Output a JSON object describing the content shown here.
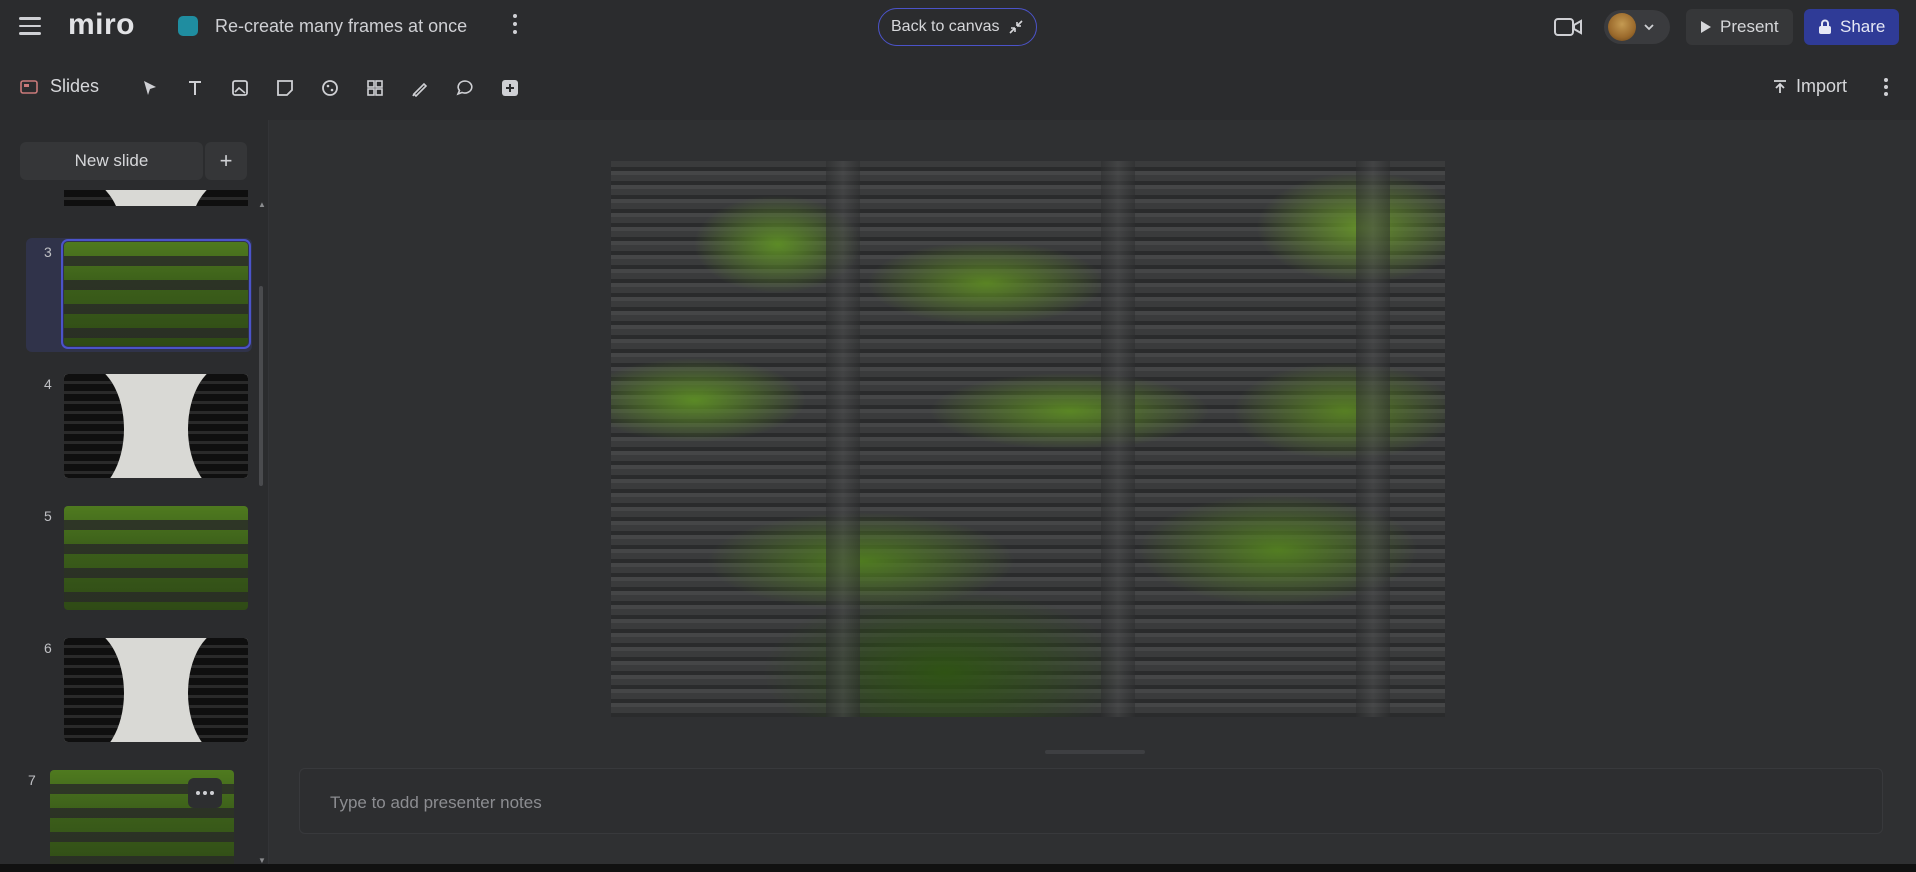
{
  "app": {
    "logo": "miro",
    "board_title": "Re-create many frames at once"
  },
  "header": {
    "back_to_canvas": "Back to canvas",
    "present": "Present",
    "share": "Share"
  },
  "toolbar": {
    "slides_label": "Slides",
    "import_label": "Import",
    "tools": [
      "select-icon",
      "text-icon",
      "image-icon",
      "sticky-note-icon",
      "shapes-icon",
      "templates-icon",
      "pen-icon",
      "comment-icon",
      "add-icon"
    ]
  },
  "sidebar": {
    "new_slide": "New slide",
    "add": "+",
    "slides": [
      {
        "number": "3",
        "thumbnail": "green-building",
        "selected": true
      },
      {
        "number": "4",
        "thumbnail": "black-white-building",
        "selected": false
      },
      {
        "number": "5",
        "thumbnail": "green-building",
        "selected": false
      },
      {
        "number": "6",
        "thumbnail": "black-white-building",
        "selected": false
      },
      {
        "number": "7",
        "thumbnail": "green-building",
        "selected": false
      }
    ]
  },
  "editor": {
    "notes_placeholder": "Type to add presenter notes"
  },
  "colors": {
    "accent": "#4b53c9",
    "share_bg": "#2f3b97",
    "board_icon": "#1f8da0"
  }
}
